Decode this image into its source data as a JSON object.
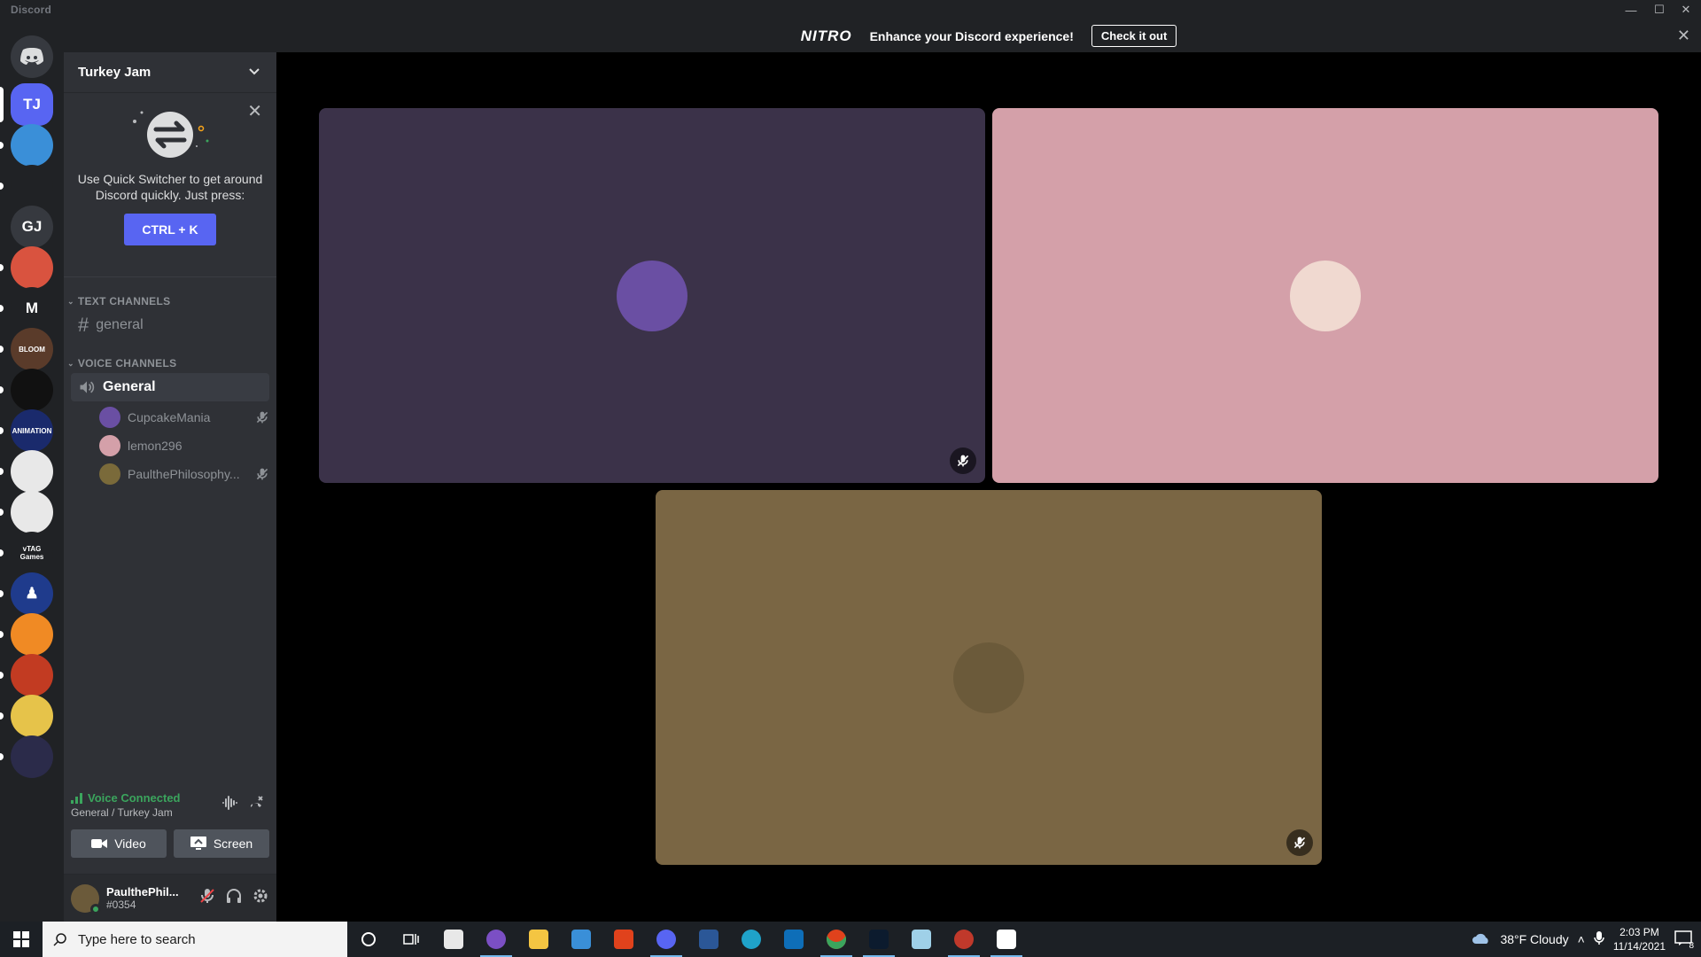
{
  "window": {
    "title": "Discord",
    "minimize": "—",
    "maximize": "☐",
    "close": "✕"
  },
  "banner": {
    "logo": "NITRO",
    "text": "Enhance your Discord experience!",
    "button": "Check it out",
    "close": "✕"
  },
  "guilds": [
    {
      "name": "home",
      "initials": "",
      "color": "#36393f"
    },
    {
      "name": "turkey-jam",
      "initials": "TJ",
      "color": "#5865f2"
    },
    {
      "name": "server-blue-character",
      "initials": "",
      "color": "#3a8fd8"
    },
    {
      "name": "server-controller",
      "initials": "",
      "color": "#202225"
    },
    {
      "name": "server-gj",
      "initials": "GJ",
      "color": "#36393f"
    },
    {
      "name": "server-red-badge",
      "initials": "",
      "color": "#d9533f"
    },
    {
      "name": "server-m",
      "initials": "M",
      "color": "#202225"
    },
    {
      "name": "server-bloom",
      "initials": "BLOOM",
      "color": "#5a3b2a"
    },
    {
      "name": "server-colorful",
      "initials": "",
      "color": "#111111"
    },
    {
      "name": "server-animation",
      "initials": "ANIMATION",
      "color": "#1a2a6c"
    },
    {
      "name": "server-studio-1",
      "initials": "",
      "color": "#e8e8e8"
    },
    {
      "name": "server-studio-2",
      "initials": "",
      "color": "#e8e8e8"
    },
    {
      "name": "server-vtag",
      "initials": "vTAG Games",
      "color": "#202225"
    },
    {
      "name": "server-chess",
      "initials": "♟",
      "color": "#1f3b8c"
    },
    {
      "name": "server-fire",
      "initials": "",
      "color": "#f08a24"
    },
    {
      "name": "server-red-logo",
      "initials": "",
      "color": "#c23b22"
    },
    {
      "name": "server-yellow",
      "initials": "",
      "color": "#e6c34a"
    },
    {
      "name": "server-pixel",
      "initials": "",
      "color": "#2b2b4a"
    }
  ],
  "server": {
    "name": "Turkey Jam"
  },
  "quick_switcher": {
    "text": "Use Quick Switcher to get around Discord quickly. Just press:",
    "button": "CTRL + K"
  },
  "categories": {
    "text": "TEXT CHANNELS",
    "voice": "VOICE CHANNELS"
  },
  "text_channels": [
    {
      "name": "general"
    }
  ],
  "voice_channel": {
    "name": "General"
  },
  "voice_users": [
    {
      "name": "CupcakeMania",
      "muted": true,
      "color": "#6a4fa3"
    },
    {
      "name": "lemon296",
      "muted": false,
      "color": "#d4a0a9"
    },
    {
      "name": "PaulthePhilosophy...",
      "muted": true,
      "color": "#7a6a3a"
    }
  ],
  "voice_panel": {
    "status": "Voice Connected",
    "location": "General / Turkey Jam",
    "video": "Video",
    "screen": "Screen"
  },
  "user": {
    "name": "PaulthePhil...",
    "tag": "#0354"
  },
  "tiles": [
    {
      "user": "CupcakeMania",
      "bg": "#3b3249",
      "avatar": "#6a4fa3",
      "muted": true
    },
    {
      "user": "lemon296",
      "bg": "#d4a0a9",
      "avatar": "#f0d9d0",
      "muted": false
    },
    {
      "user": "PaulthePhilosophy",
      "bg": "#7a6644",
      "avatar": "#6b5a3a",
      "muted": true
    }
  ],
  "taskbar": {
    "search_placeholder": "Type here to search",
    "weather": "38°F  Cloudy",
    "time": "2:03 PM",
    "date": "11/14/2021",
    "notifications": "8"
  }
}
